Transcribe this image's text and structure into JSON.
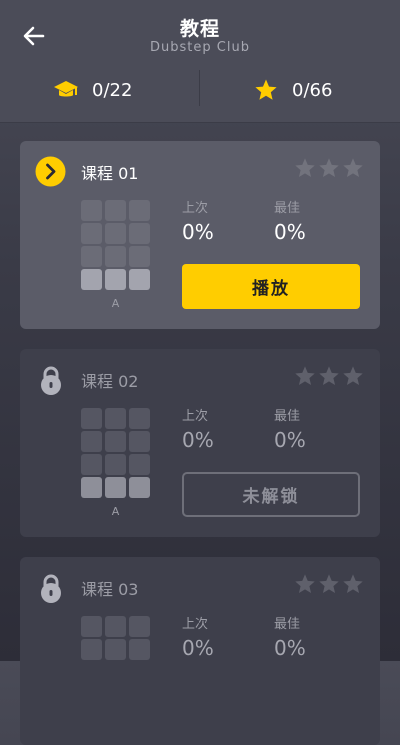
{
  "header": {
    "title": "教程",
    "subtitle": "Dubstep Club",
    "lessons_progress": "0/22",
    "stars_progress": "0/66"
  },
  "labels": {
    "last": "上次",
    "best": "最佳"
  },
  "colors": {
    "accent": "#ffcd00",
    "card_active": "#5b5c68",
    "card_locked": "#3e3f4b"
  },
  "lessons": [
    {
      "title": "课程 01",
      "status": "active",
      "stars_earned": 0,
      "stars_total": 3,
      "last": "0%",
      "best": "0%",
      "pad_label": "A",
      "action_label": "播放"
    },
    {
      "title": "课程 02",
      "status": "locked",
      "stars_earned": 0,
      "stars_total": 3,
      "last": "0%",
      "best": "0%",
      "pad_label": "A",
      "action_label": "未解锁"
    },
    {
      "title": "课程 03",
      "status": "locked",
      "stars_earned": 0,
      "stars_total": 3,
      "last": "0%",
      "best": "0%"
    }
  ]
}
